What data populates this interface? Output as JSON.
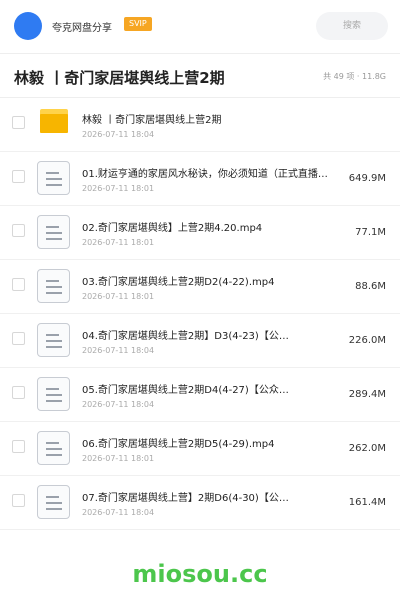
{
  "header": {
    "app_name": "夸克网盘分享",
    "badge": "SVIP",
    "search_placeholder": "搜索",
    "avatar_color": "#2f7bf2"
  },
  "folder": {
    "title": "林毅 丨奇门家居堪舆线上营2期",
    "stats": "共 49 项 · 11.8G"
  },
  "files": [
    {
      "type": "folder",
      "icon": "folder-icon",
      "name": "林毅 丨奇门家居堪舆线上营2期",
      "date": "2026-07-11 18:04",
      "size": ""
    },
    {
      "type": "file",
      "icon": "file-icon",
      "name": "01.财运亨通的家居风水秘诀，你必须知道（正式直播…",
      "date": "2026-07-11 18:01",
      "size": "649.9M"
    },
    {
      "type": "file",
      "icon": "file-icon",
      "name": "02.奇门家居堪舆线】上营2期4.20.mp4",
      "date": "2026-07-11 18:01",
      "size": "77.1M"
    },
    {
      "type": "file",
      "icon": "file-icon",
      "name": "03.奇门家居堪舆线上营2期D2(4-22).mp4",
      "date": "2026-07-11 18:01",
      "size": "88.6M"
    },
    {
      "type": "file",
      "icon": "file-icon",
      "name": "04.奇门家居堪舆线上营2期】D3(4-23)【公…",
      "date": "2026-07-11 18:04",
      "size": "226.0M"
    },
    {
      "type": "file",
      "icon": "file-icon",
      "name": "05.奇门家居堪舆线上营2期D4(4-27)【公众…",
      "date": "2026-07-11 18:04",
      "size": "289.4M"
    },
    {
      "type": "file",
      "icon": "file-icon",
      "name": "06.奇门家居堪舆线上营2期D5(4-29).mp4",
      "date": "2026-07-11 18:01",
      "size": "262.0M"
    },
    {
      "type": "file",
      "icon": "file-icon",
      "name": "07.奇门家居堪舆线上营】2期D6(4-30)【公…",
      "date": "2026-07-11 18:04",
      "size": "161.4M"
    }
  ],
  "watermark": "miosou.cc",
  "colors": {
    "accent": "#2f7bf2",
    "svip": "#f6a623",
    "folder": "#f7b500",
    "watermark": "#4cc64c"
  }
}
